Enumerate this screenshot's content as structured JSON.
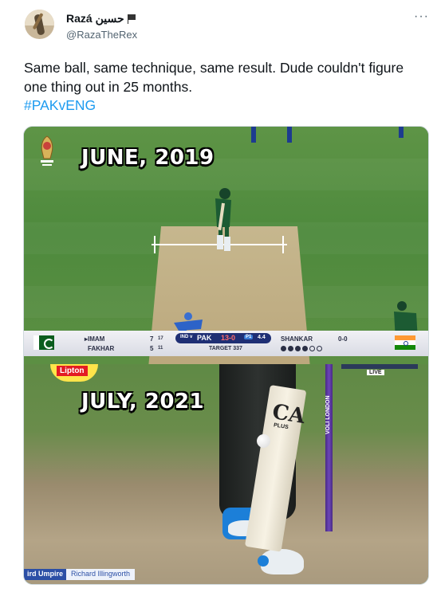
{
  "user": {
    "name": "Razá حسین",
    "handle": "@RazaTheRex",
    "avatar_icon": "cricket-batsman-avatar",
    "badge_icon": "flag-icon"
  },
  "menu": {
    "more_label": "···"
  },
  "tweet": {
    "text": "Same ball, same technique, same result. Dude couldn't figure one thing out in 25 months.",
    "hashtag": "#PAKvENG"
  },
  "media": {
    "top_caption": "JUNE, 2019",
    "bottom_caption": "JULY, 2021",
    "scoreboard": {
      "batsman1": "▸IMAM",
      "batsman1_runs": "7",
      "batsman1_balls": "17",
      "batsman2": "FAKHAR",
      "batsman2_runs": "5",
      "batsman2_balls": "11",
      "matchup": "IND v",
      "team": "PAK",
      "score": "13-0",
      "phase": "P1",
      "overs": "4.4",
      "target": "TARGET 337",
      "bowler": "SHANKAR",
      "bowler_figures": "0-0",
      "balls_bowled": 4,
      "balls_total": 6
    },
    "sponsor": "Lipton",
    "bat_brand": "CA",
    "bat_model": "PLUS",
    "stump_text": "VOLI LONDON",
    "live_badge": "LIVE",
    "umpire_label": "ird Umpire",
    "umpire_name": "Richard Illingworth",
    "colors": {
      "scoreboard_center": "#1f2f74",
      "stump": "#6b46b8",
      "umpire_bar": "#2c4fa6"
    }
  }
}
